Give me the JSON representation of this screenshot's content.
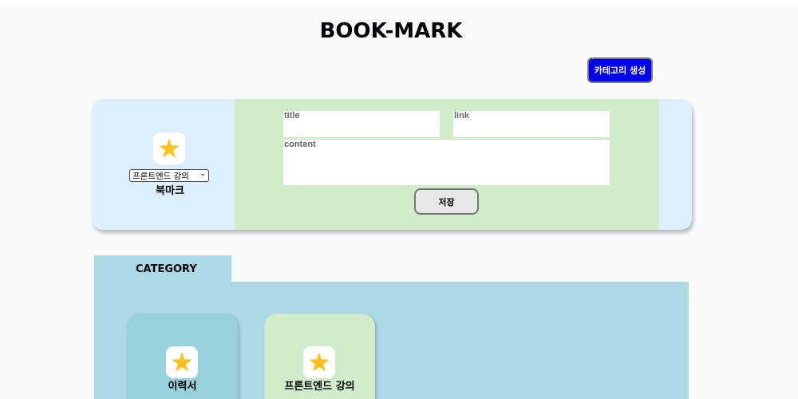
{
  "header": {
    "title": "BOOK-MARK"
  },
  "toolbar": {
    "create_category_label": "카테고리 생성"
  },
  "form": {
    "selected_category": "프론트엔드 강의",
    "icon": "star-icon",
    "label": "북마크",
    "title_label": "title",
    "link_label": "link",
    "content_label": "content",
    "save_label": "저장"
  },
  "categories": {
    "tab_label": "CATEGORY",
    "items": [
      {
        "label": "이력서",
        "icon": "star-icon",
        "color": "#98d0dc"
      },
      {
        "label": "프론트엔드 강의",
        "icon": "star-icon",
        "color": "#d0ecca"
      }
    ]
  },
  "colors": {
    "accent": "#0000ee",
    "panel": "#add8e6",
    "form_bg": "#d0ecca",
    "card_bg": "#ddeefe"
  }
}
